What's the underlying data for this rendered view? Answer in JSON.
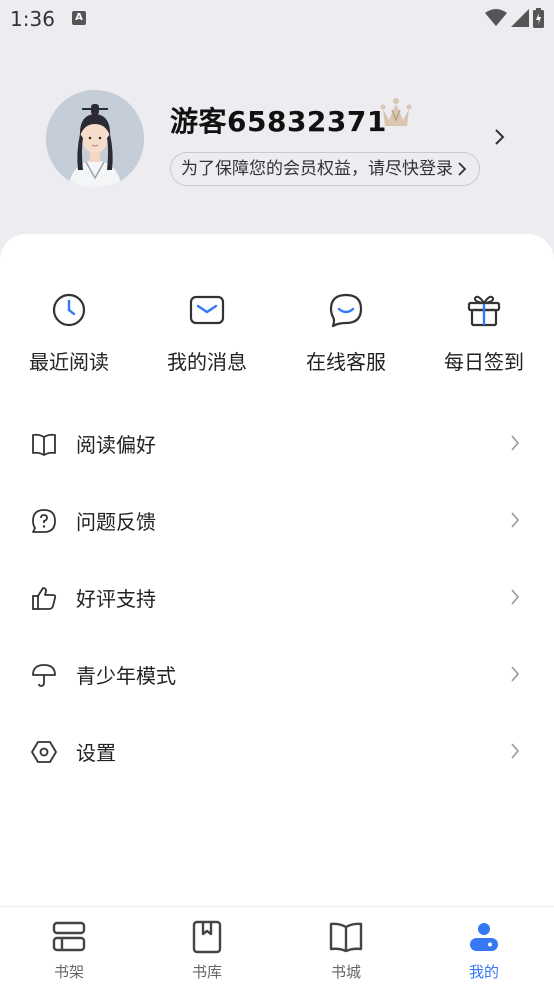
{
  "status_bar": {
    "time": "1:36",
    "notification_badge": "A"
  },
  "profile": {
    "username": "游客65832371",
    "login_prompt": "为了保障您的会员权益，请尽快登录"
  },
  "shortcuts": [
    {
      "label": "最近阅读",
      "icon": "clock-icon"
    },
    {
      "label": "我的消息",
      "icon": "envelope-icon"
    },
    {
      "label": "在线客服",
      "icon": "chat-icon"
    },
    {
      "label": "每日签到",
      "icon": "gift-icon"
    }
  ],
  "menu": [
    {
      "label": "阅读偏好",
      "icon": "book-icon"
    },
    {
      "label": "问题反馈",
      "icon": "question-icon"
    },
    {
      "label": "好评支持",
      "icon": "thumbs-up-icon"
    },
    {
      "label": "青少年模式",
      "icon": "umbrella-icon"
    },
    {
      "label": "设置",
      "icon": "settings-icon"
    }
  ],
  "tabs": [
    {
      "label": "书架",
      "icon": "bookshelf-icon"
    },
    {
      "label": "书库",
      "icon": "library-icon"
    },
    {
      "label": "书城",
      "icon": "open-book-icon"
    },
    {
      "label": "我的",
      "icon": "profile-icon"
    }
  ],
  "colors": {
    "accent": "#3478f6",
    "icon": "#333333",
    "background": "#ececf1"
  }
}
